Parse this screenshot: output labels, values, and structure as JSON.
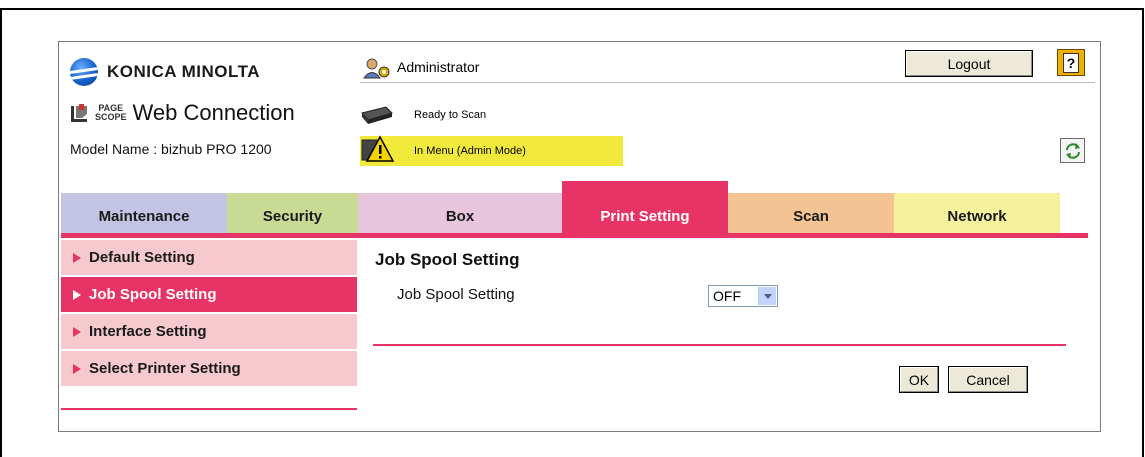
{
  "header": {
    "brand": "KONICA MINOLTA",
    "product_mark": "PAGE\nSCOPE",
    "product": "Web Connection",
    "model_name": "Model Name : bizhub PRO 1200",
    "user": "Administrator",
    "logout_label": "Logout",
    "help_label": "?",
    "status_ready": "Ready to Scan",
    "status_warning": "In Menu (Admin Mode)"
  },
  "tabs": [
    {
      "label": "Maintenance",
      "active": false
    },
    {
      "label": "Security",
      "active": false
    },
    {
      "label": "Box",
      "active": false
    },
    {
      "label": "Print Setting",
      "active": true
    },
    {
      "label": "Scan",
      "active": false
    },
    {
      "label": "Network",
      "active": false
    }
  ],
  "sidebar": {
    "items": [
      {
        "label": "Default Setting",
        "active": false
      },
      {
        "label": "Job Spool Setting",
        "active": true
      },
      {
        "label": "Interface Setting",
        "active": false
      },
      {
        "label": "Select Printer Setting",
        "active": false
      }
    ]
  },
  "main": {
    "title": "Job Spool Setting",
    "field_label": "Job Spool Setting",
    "field_value": "OFF",
    "ok_label": "OK",
    "cancel_label": "Cancel"
  },
  "colors": {
    "accent": "#e83366",
    "warning": "#f2ea3b",
    "tab_maintenance": "#c3c4e3",
    "tab_security": "#c8da93",
    "tab_box": "#e7c6dd",
    "tab_scan": "#f3c394",
    "tab_network": "#f6f19d",
    "sidebar_bg": "#f6c9cf"
  },
  "icons": [
    "globe-logo-icon",
    "pagescope-icon",
    "admin-user-icon",
    "help-icon",
    "scanner-icon",
    "warning-icon",
    "refresh-icon",
    "dropdown-arrow-icon",
    "triangle-bullet-icon"
  ]
}
